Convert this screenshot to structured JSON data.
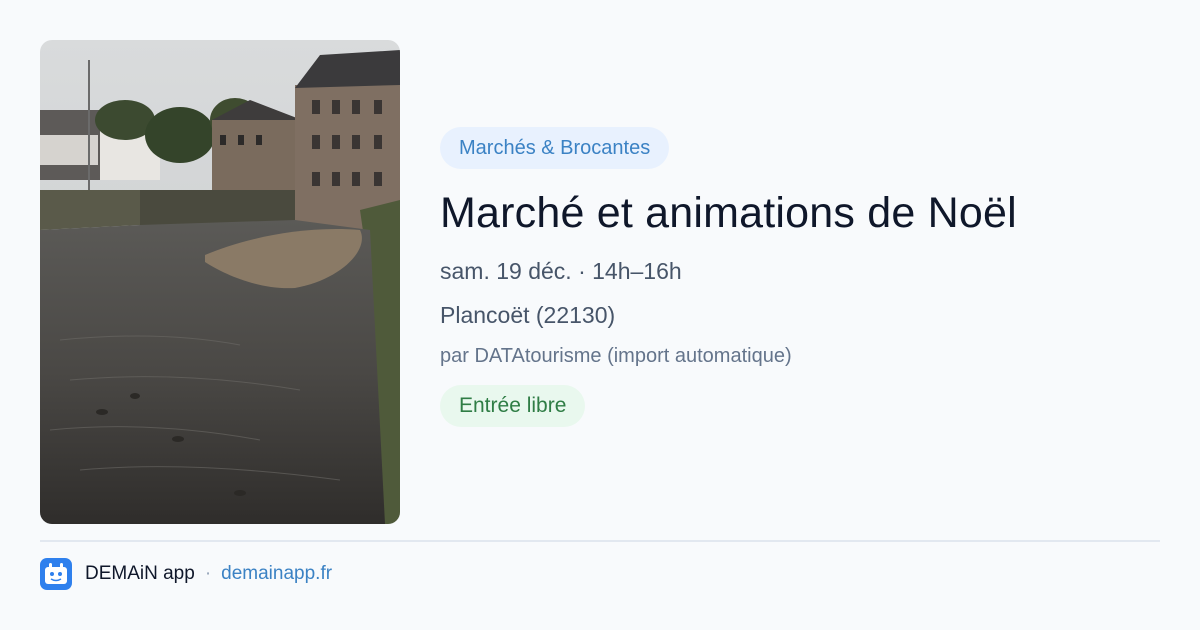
{
  "event": {
    "category": "Marchés & Brocantes",
    "title": "Marché et animations de Noël",
    "datetime": "sam. 19 déc. · 14h–16h",
    "location": "Plancoët (22130)",
    "source": "par DATAtourisme (import automatique)",
    "price": "Entrée libre"
  },
  "footer": {
    "app_name": "DEMAiN app",
    "separator": "·",
    "url": "demainapp.fr"
  },
  "colors": {
    "background": "#f8fafc",
    "category_bg": "#e8f1fe",
    "category_text": "#3b82c4",
    "price_bg": "#e9f8ee",
    "price_text": "#2f7d45",
    "link": "#3b82c4",
    "logo": "#2f80ed"
  },
  "icons": {
    "app_logo": "demain-calendar-logo-icon"
  }
}
